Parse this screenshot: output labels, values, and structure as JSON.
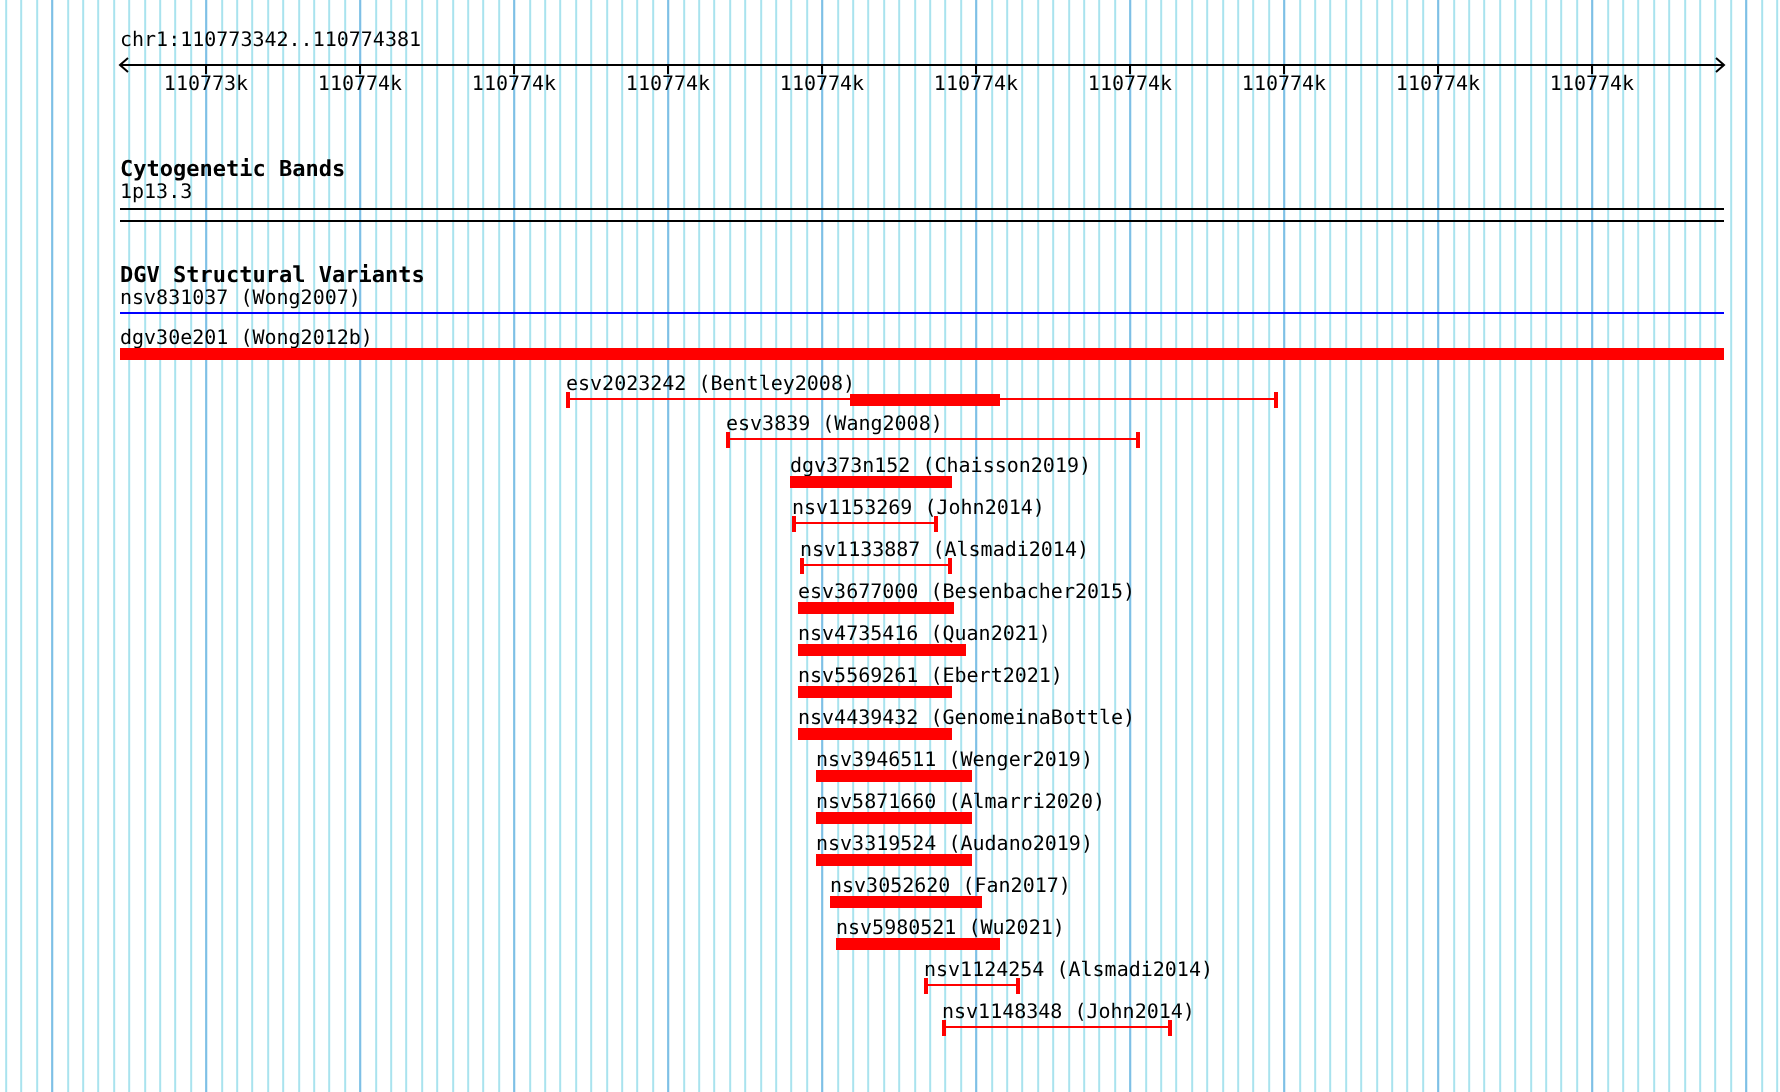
{
  "ruler": {
    "position": "chr1:110773342..110774381",
    "ticks": [
      "110773k",
      "110774k",
      "110774k",
      "110774k",
      "110774k",
      "110774k",
      "110774k",
      "110774k",
      "110774k",
      "110774k"
    ]
  },
  "tracks": [
    {
      "title": "Cytogenetic Bands",
      "kind": "bands",
      "band": "1p13.3"
    },
    {
      "title": "DGV Structural Variants",
      "kind": "variants",
      "features": [
        {
          "label": "nsv831037 (Wong2007)",
          "kind": "line",
          "color": "#0000ff"
        },
        {
          "label": "dgv30e201 (Wong2012b)",
          "kind": "bar",
          "color": "#ff0000"
        },
        {
          "label": "esv2023242 (Bentley2008)",
          "kind": "split",
          "color": "#ff0000"
        },
        {
          "label": "esv3839 (Wang2008)",
          "kind": "span",
          "color": "#ff0000"
        },
        {
          "label": "dgv373n152 (Chaisson2019)",
          "kind": "bar",
          "color": "#ff0000"
        },
        {
          "label": "nsv1153269 (John2014)",
          "kind": "span",
          "color": "#ff0000"
        },
        {
          "label": "nsv1133887 (Alsmadi2014)",
          "kind": "span",
          "color": "#ff0000"
        },
        {
          "label": "esv3677000 (Besenbacher2015)",
          "kind": "bar",
          "color": "#ff0000"
        },
        {
          "label": "nsv4735416 (Quan2021)",
          "kind": "bar",
          "color": "#ff0000"
        },
        {
          "label": "nsv5569261 (Ebert2021)",
          "kind": "bar",
          "color": "#ff0000"
        },
        {
          "label": "nsv4439432 (GenomeinaBottle)",
          "kind": "bar",
          "color": "#ff0000"
        },
        {
          "label": "nsv3946511 (Wenger2019)",
          "kind": "bar",
          "color": "#ff0000"
        },
        {
          "label": "nsv5871660 (Almarri2020)",
          "kind": "bar",
          "color": "#ff0000"
        },
        {
          "label": "nsv3319524 (Audano2019)",
          "kind": "bar",
          "color": "#ff0000"
        },
        {
          "label": "nsv3052620 (Fan2017)",
          "kind": "bar",
          "color": "#ff0000"
        },
        {
          "label": "nsv5980521 (Wu2021)",
          "kind": "bar",
          "color": "#ff0000"
        },
        {
          "label": "nsv1124254 (Alsmadi2014)",
          "kind": "span",
          "color": "#ff0000"
        },
        {
          "label": "nsv1148348 (John2014)",
          "kind": "span",
          "color": "#ff0000"
        }
      ]
    }
  ]
}
